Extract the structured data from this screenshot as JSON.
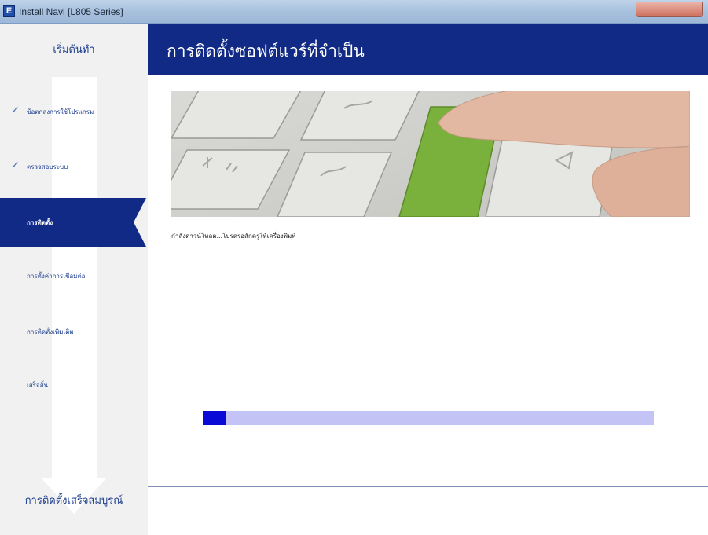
{
  "window": {
    "title": "Install Navi [L805 Series]",
    "app_icon_letter": "E"
  },
  "sidebar": {
    "top_label": "เริ่มต้นทำ",
    "steps": [
      {
        "label": "ข้อตกลงการใช้โปรแกรม",
        "completed": true,
        "active": false
      },
      {
        "label": "ตรวจสอบระบบ",
        "completed": true,
        "active": false
      },
      {
        "label": "การติดตั้ง",
        "completed": false,
        "active": true
      },
      {
        "label": "การตั้งค่าการเชื่อมต่อ",
        "completed": false,
        "active": false
      },
      {
        "label": "การติดตั้งเพิ่มเติม",
        "completed": false,
        "active": false
      },
      {
        "label": "เสร็จสิ้น",
        "completed": false,
        "active": false
      }
    ],
    "bottom_label": "การติดตั้งเสร็จสมบูรณ์",
    "check_glyph": "✓"
  },
  "header": {
    "title": "การติดตั้งซอฟต์แวร์ที่จำเป็น"
  },
  "main": {
    "status_text": "กำลังดาวน์โหลด...โปรดรอสักครู่ให้เครื่องพิมพ์",
    "progress_fraction": 0.05
  },
  "colors": {
    "accent": "#102a86",
    "progress_fill": "#0a0ad6",
    "progress_track": "#c3c4f5",
    "sidebar_bg": "#f1f1f1"
  },
  "icons": {
    "app": "epson-app-icon",
    "check": "check-icon"
  }
}
